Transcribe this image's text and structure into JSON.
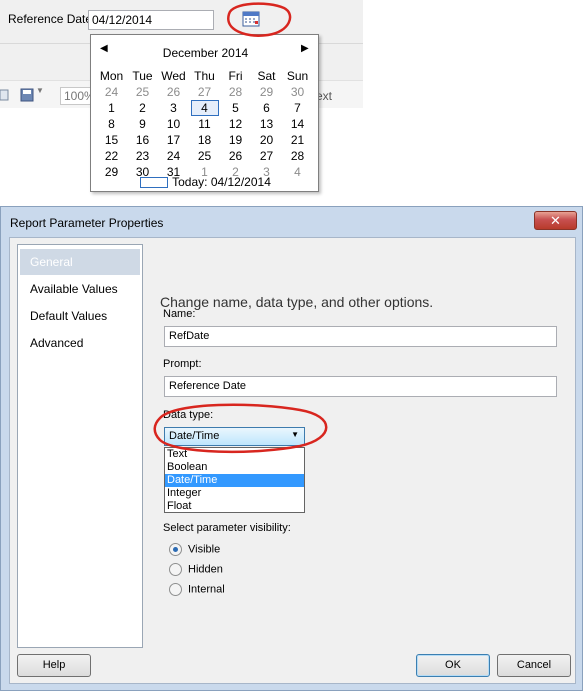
{
  "viewer": {
    "param_label": "Reference Date",
    "date_value": "04/12/2014",
    "zoom_text": "100%",
    "next_text": "ext"
  },
  "calendar": {
    "month_title": "December 2014",
    "weekdays": [
      "Mon",
      "Tue",
      "Wed",
      "Thu",
      "Fri",
      "Sat",
      "Sun"
    ],
    "weeks": [
      [
        "24",
        "25",
        "26",
        "27",
        "28",
        "29",
        "30"
      ],
      [
        "1",
        "2",
        "3",
        "4",
        "5",
        "6",
        "7"
      ],
      [
        "8",
        "9",
        "10",
        "11",
        "12",
        "13",
        "14"
      ],
      [
        "15",
        "16",
        "17",
        "18",
        "19",
        "20",
        "21"
      ],
      [
        "22",
        "23",
        "24",
        "25",
        "26",
        "27",
        "28"
      ],
      [
        "29",
        "30",
        "31",
        "1",
        "2",
        "3",
        "4"
      ]
    ],
    "today_label": "Today: 04/12/2014"
  },
  "dialog": {
    "title": "Report Parameter Properties",
    "close_label": "✕",
    "nav_items": [
      "General",
      "Available Values",
      "Default Values",
      "Advanced"
    ],
    "heading": "Change name, data type, and other options.",
    "name_label": "Name:",
    "name_value": "RefDate",
    "prompt_label": "Prompt:",
    "prompt_value": "Reference Date",
    "datatype_label": "Data type:",
    "datatype_value": "Date/Time",
    "datatype_options": [
      "Text",
      "Boolean",
      "Date/Time",
      "Integer",
      "Float"
    ],
    "visibility_label": "Select parameter visibility:",
    "visibility_options": [
      "Visible",
      "Hidden",
      "Internal"
    ],
    "help_label": "Help",
    "ok_label": "OK",
    "cancel_label": "Cancel"
  },
  "colors": {
    "annotation_red": "#d8261f",
    "selection_blue": "#3399ff",
    "dialog_frame": "#c9d9ec"
  }
}
